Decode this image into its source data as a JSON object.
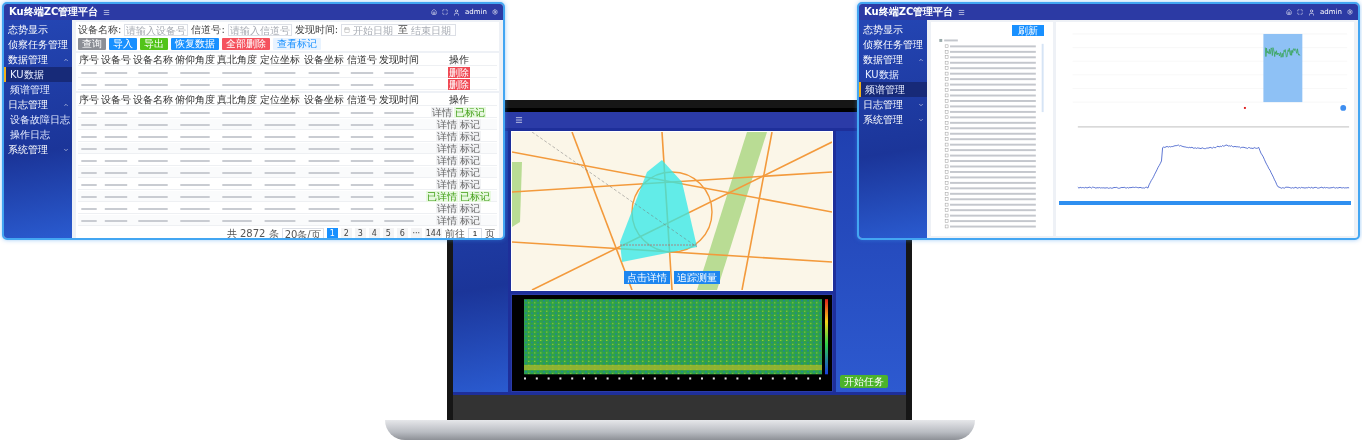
{
  "left_window": {
    "title": "Ku终端ZC管理平台",
    "user": "admin",
    "sidebar": [
      {
        "label": "态势显示"
      },
      {
        "label": "侦察任务管理"
      },
      {
        "label": "数据管理",
        "expanded": true,
        "children": [
          {
            "label": "KU数据",
            "selected": true
          },
          {
            "label": "频谱管理",
            "selected": false
          }
        ]
      },
      {
        "label": "日志管理",
        "expanded": true,
        "children": [
          {
            "label": "设备故障日志",
            "selected": false
          },
          {
            "label": "操作日志",
            "selected": false
          }
        ]
      },
      {
        "label": "系统管理",
        "expanded": false
      }
    ],
    "filters": [
      {
        "label": "设备名称:",
        "placeholder": "请输入设备号"
      },
      {
        "label": "信道号:",
        "placeholder": "请输入信道号"
      }
    ],
    "date_filter": {
      "label": "发现时间:",
      "start_placeholder": "开始日期",
      "separator": "至",
      "end_placeholder": "结束日期"
    },
    "buttons": [
      {
        "label": "查询",
        "kind": "grey"
      },
      {
        "label": "导入",
        "kind": "blue"
      },
      {
        "label": "导出",
        "kind": "green"
      },
      {
        "label": "恢复数据",
        "kind": "blue"
      },
      {
        "label": "全部删除",
        "kind": "red"
      },
      {
        "label": "查看标记",
        "kind": "light"
      }
    ],
    "marked_columns": [
      "序号",
      "设备号",
      "设备名称",
      "俯仰角度",
      "真北角度",
      "定位坐标",
      "设备坐标",
      "信道号",
      "发现时间",
      "操作"
    ],
    "marked_rows": [
      {
        "action": "删除"
      },
      {
        "action": "删除"
      }
    ],
    "columns": [
      "序号",
      "设备号",
      "设备名称",
      "俯仰角度",
      "真北角度",
      "定位坐标",
      "设备坐标",
      "信道号",
      "发现时间",
      "操作"
    ],
    "rows": [
      {
        "actions": [
          {
            "label": "详情",
            "done": false
          },
          {
            "label": "已标记",
            "done": true
          }
        ]
      },
      {
        "actions": [
          {
            "label": "详情",
            "done": false
          },
          {
            "label": "标记",
            "done": false
          }
        ]
      },
      {
        "actions": [
          {
            "label": "详情",
            "done": false
          },
          {
            "label": "标记",
            "done": false
          }
        ]
      },
      {
        "actions": [
          {
            "label": "详情",
            "done": false
          },
          {
            "label": "标记",
            "done": false
          }
        ]
      },
      {
        "actions": [
          {
            "label": "详情",
            "done": false
          },
          {
            "label": "标记",
            "done": false
          }
        ]
      },
      {
        "actions": [
          {
            "label": "详情",
            "done": false
          },
          {
            "label": "标记",
            "done": false
          }
        ]
      },
      {
        "actions": [
          {
            "label": "详情",
            "done": false
          },
          {
            "label": "标记",
            "done": false
          }
        ]
      },
      {
        "actions": [
          {
            "label": "已详情",
            "done": true
          },
          {
            "label": "已标记",
            "done": true
          }
        ]
      },
      {
        "actions": [
          {
            "label": "详情",
            "done": false
          },
          {
            "label": "标记",
            "done": false
          }
        ]
      },
      {
        "actions": [
          {
            "label": "详情",
            "done": false
          },
          {
            "label": "标记",
            "done": false
          }
        ]
      }
    ],
    "pagination": {
      "total": "共 2872 条",
      "page_size": "20条/页",
      "pages": [
        {
          "label": "1",
          "selected": true
        },
        {
          "label": "2",
          "selected": false
        },
        {
          "label": "3",
          "selected": false
        },
        {
          "label": "4",
          "selected": false
        },
        {
          "label": "5",
          "selected": false
        },
        {
          "label": "6",
          "selected": false
        },
        {
          "label": "···",
          "selected": false
        },
        {
          "label": "144",
          "selected": false
        }
      ],
      "goto_label": "前往",
      "goto_value": "1",
      "goto_suffix": "页"
    }
  },
  "laptop": {
    "map_buttons": [
      "点击详情",
      "追踪测量"
    ],
    "info_panel": {
      "button": "开始任务"
    }
  },
  "right_window": {
    "title": "Ku终端ZC管理平台",
    "user": "admin",
    "sidebar": [
      {
        "label": "态势显示"
      },
      {
        "label": "侦察任务管理"
      },
      {
        "label": "数据管理",
        "expanded": true,
        "children": [
          {
            "label": "KU数据",
            "selected": false
          },
          {
            "label": "频谱管理",
            "selected": true
          }
        ]
      },
      {
        "label": "日志管理",
        "expanded": false
      },
      {
        "label": "系统管理",
        "expanded": false
      }
    ],
    "tree_button": "刷新"
  }
}
